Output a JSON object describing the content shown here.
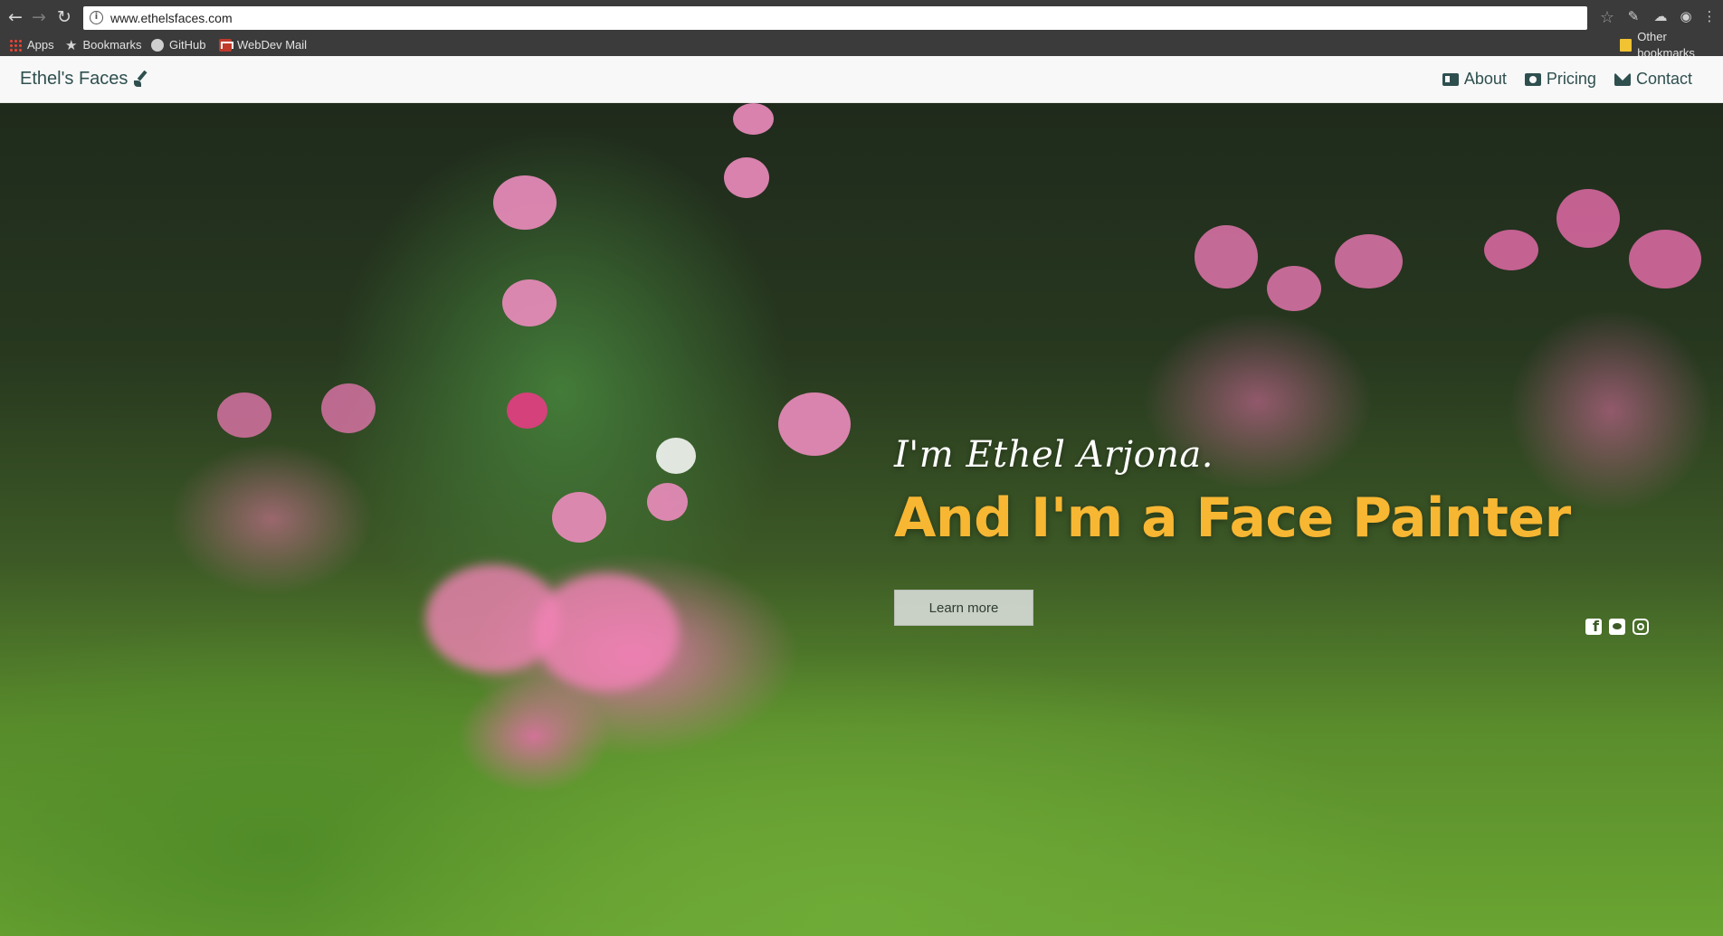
{
  "browser": {
    "url": "www.ethelsfaces.com",
    "bookmarks": [
      {
        "label": "Apps",
        "icon": "apps-grid-icon"
      },
      {
        "label": "Bookmarks",
        "icon": "star-icon"
      },
      {
        "label": "GitHub",
        "icon": "github-icon"
      },
      {
        "label": "WebDev Mail",
        "icon": "mail-icon"
      }
    ],
    "other_bookmarks": "Other bookmarks"
  },
  "site": {
    "brand": "Ethel's Faces",
    "nav": [
      {
        "label": "About",
        "icon": "id-card-icon"
      },
      {
        "label": "Pricing",
        "icon": "money-icon"
      },
      {
        "label": "Contact",
        "icon": "envelope-icon"
      }
    ],
    "hero": {
      "subhead": "I'm Ethel Arjona.",
      "headline": "And I'm a Face Painter",
      "button": "Learn more"
    },
    "social": [
      "facebook-icon",
      "twitter-icon",
      "instagram-icon"
    ],
    "colors": {
      "headline": "#f7b733",
      "brand_text": "#2f4f4f",
      "navbar_bg": "#f8f8f8"
    }
  }
}
